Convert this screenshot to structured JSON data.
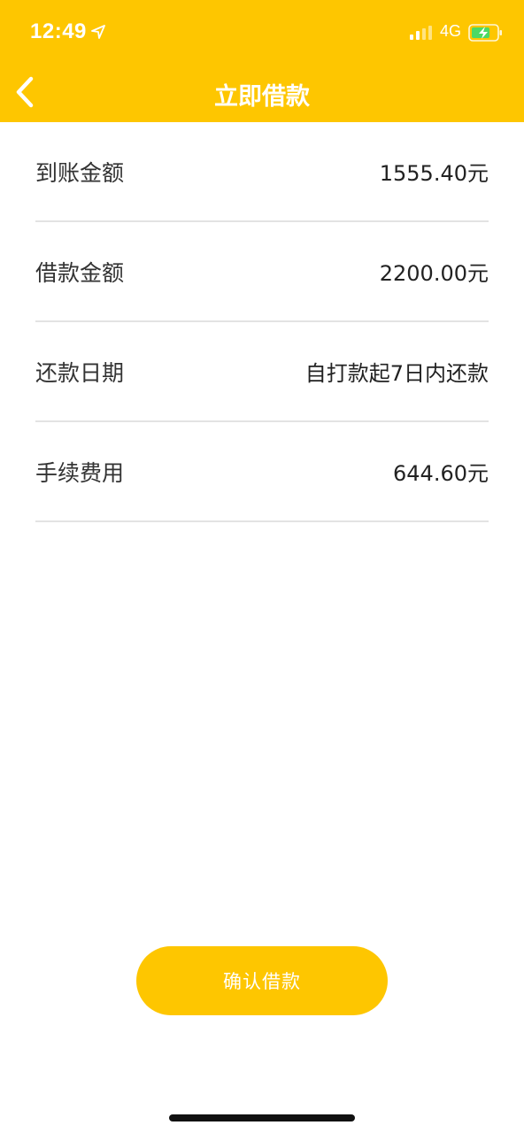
{
  "status_bar": {
    "time": "12:49",
    "network": "4G",
    "icons": [
      "location-arrow-icon",
      "signal-icon",
      "battery-charging-icon"
    ]
  },
  "nav": {
    "title": "立即借款",
    "back_icon": "chevron-left-icon"
  },
  "details": [
    {
      "label": "到账金额",
      "value": "1555.40元"
    },
    {
      "label": "借款金额",
      "value": "2200.00元"
    },
    {
      "label": "还款日期",
      "value": "自打款起7日内还款"
    },
    {
      "label": "手续费用",
      "value": "644.60元"
    }
  ],
  "confirm_label": "确认借款",
  "colors": {
    "accent": "#FEC600",
    "battery_fill": "#4CD964",
    "divider": "#E3E3E3"
  }
}
